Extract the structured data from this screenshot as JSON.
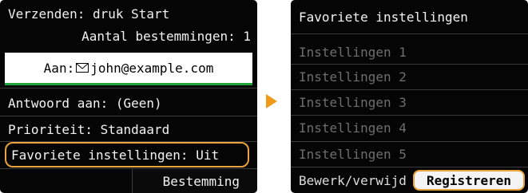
{
  "left_screen": {
    "title": "Verzenden: druk Start",
    "destinations_count": "Aantal bestemmingen: 1",
    "to_field": {
      "label": "Aan:",
      "icon": "envelope-icon",
      "value": "john@example.com"
    },
    "items": [
      {
        "label": "Antwoord aan: (Geen)"
      },
      {
        "label": "Prioriteit: Standaard"
      },
      {
        "label": "Favoriete instellingen: Uit"
      }
    ],
    "destination_button": "Bestemming"
  },
  "right_screen": {
    "title": "Favoriete instellingen",
    "settings": [
      {
        "label": "Instellingen 1"
      },
      {
        "label": "Instellingen 2"
      },
      {
        "label": "Instellingen 3"
      },
      {
        "label": "Instellingen 4"
      },
      {
        "label": "Instellingen 5"
      }
    ],
    "edit_delete": "Bewerk/verwijd",
    "register_button": "Registreren"
  },
  "colors": {
    "highlight": "#e8a33c",
    "arrow": "#f09a1a",
    "accent_line": "#1fa33a",
    "disabled_text": "#6e6e6e"
  }
}
